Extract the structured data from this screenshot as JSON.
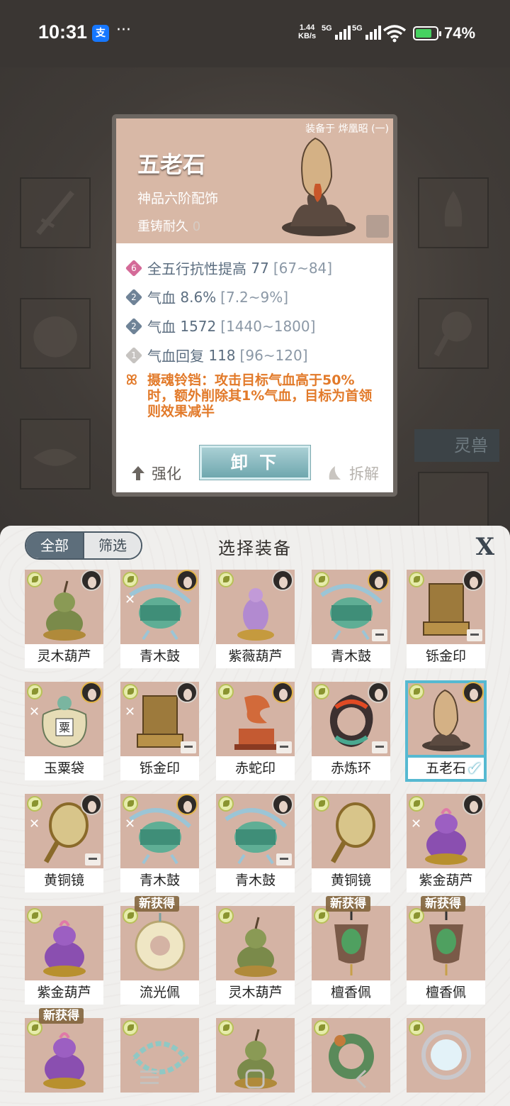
{
  "status_bar": {
    "time": "10:31",
    "alipay": "支",
    "more": "···",
    "net_speed_top": "1.44",
    "net_speed_unit": "KB/s",
    "sig1": "5G",
    "sig2": "5G",
    "battery": "74%"
  },
  "background": {
    "spirit_beast_label": "灵兽"
  },
  "detail": {
    "equipped_on": "装备于 烨凰昭 (一)",
    "name": "五老石",
    "grade": "神品六阶配饰",
    "durability_label": "重铸耐久",
    "durability_value": "0",
    "stats": [
      {
        "level": "6",
        "name": "全五行抗性提高",
        "value": "77",
        "range": "[67~84]"
      },
      {
        "level": "2",
        "name": "气血",
        "value": "8.6%",
        "range": "[7.2~9%]"
      },
      {
        "level": "2",
        "name": "气血",
        "value": "1572",
        "range": "[1440~1800]"
      },
      {
        "level": "1",
        "name": "气血回复",
        "value": "118",
        "range": "[96~120]"
      }
    ],
    "special_icon": "ꕤ",
    "special": "摄魂铃铛：攻击目标气血高于50%时，额外削除其1%气血，目标为首领则效果减半",
    "strengthen_label": "强化",
    "unequip_label": "卸 下",
    "salvage_label": "拆解"
  },
  "panel": {
    "tab_all": "全部",
    "tab_filter": "筛选",
    "title": "选择装备",
    "close": "X",
    "new_tag": "新获得",
    "items": [
      {
        "label": "灵木葫芦",
        "avatar": true,
        "mark": false,
        "lock": false,
        "new": false,
        "selected": false,
        "art": "gourd-green"
      },
      {
        "label": "青木鼓",
        "avatar": true,
        "mark": true,
        "lock": false,
        "new": false,
        "selected": false,
        "art": "drum"
      },
      {
        "label": "紫薇葫芦",
        "avatar": true,
        "mark": false,
        "lock": false,
        "new": false,
        "selected": false,
        "art": "gourd-purple-slim"
      },
      {
        "label": "青木鼓",
        "avatar": true,
        "mark": false,
        "lock": true,
        "new": false,
        "selected": false,
        "art": "drum"
      },
      {
        "label": "铄金印",
        "avatar": true,
        "mark": false,
        "lock": true,
        "new": false,
        "selected": false,
        "art": "seal-gold"
      },
      {
        "label": "玉粟袋",
        "avatar": true,
        "mark": true,
        "lock": false,
        "new": false,
        "selected": false,
        "art": "bag"
      },
      {
        "label": "铄金印",
        "avatar": true,
        "mark": true,
        "lock": true,
        "new": false,
        "selected": false,
        "art": "seal-gold"
      },
      {
        "label": "赤蛇印",
        "avatar": true,
        "mark": false,
        "lock": true,
        "new": false,
        "selected": false,
        "art": "seal-snake"
      },
      {
        "label": "赤炼环",
        "avatar": true,
        "mark": false,
        "lock": true,
        "new": false,
        "selected": false,
        "art": "ring-red"
      },
      {
        "label": "五老石",
        "avatar": true,
        "mark": false,
        "lock": false,
        "new": false,
        "selected": true,
        "art": "stone"
      },
      {
        "label": "黄铜镜",
        "avatar": true,
        "mark": true,
        "lock": true,
        "new": false,
        "selected": false,
        "art": "mirror"
      },
      {
        "label": "青木鼓",
        "avatar": true,
        "mark": true,
        "lock": false,
        "new": false,
        "selected": false,
        "art": "drum"
      },
      {
        "label": "青木鼓",
        "avatar": true,
        "mark": false,
        "lock": true,
        "new": false,
        "selected": false,
        "art": "drum"
      },
      {
        "label": "黄铜镜",
        "avatar": false,
        "mark": false,
        "lock": false,
        "new": false,
        "selected": false,
        "art": "mirror"
      },
      {
        "label": "紫金葫芦",
        "avatar": true,
        "mark": true,
        "lock": false,
        "new": false,
        "selected": false,
        "art": "gourd-purple"
      },
      {
        "label": "紫金葫芦",
        "avatar": false,
        "mark": false,
        "lock": false,
        "new": false,
        "selected": false,
        "art": "gourd-purple"
      },
      {
        "label": "流光佩",
        "avatar": false,
        "mark": false,
        "lock": false,
        "new": true,
        "selected": false,
        "art": "jade-disc"
      },
      {
        "label": "灵木葫芦",
        "avatar": false,
        "mark": false,
        "lock": false,
        "new": false,
        "selected": false,
        "art": "gourd-green"
      },
      {
        "label": "檀香佩",
        "avatar": false,
        "mark": false,
        "lock": false,
        "new": true,
        "selected": false,
        "art": "pendant"
      },
      {
        "label": "檀香佩",
        "avatar": false,
        "mark": false,
        "lock": false,
        "new": true,
        "selected": false,
        "art": "pendant"
      },
      {
        "label": "",
        "avatar": false,
        "mark": false,
        "lock": false,
        "new": true,
        "selected": false,
        "art": "gourd-purple"
      },
      {
        "label": "",
        "avatar": false,
        "mark": false,
        "lock": false,
        "new": false,
        "selected": false,
        "art": "chain"
      },
      {
        "label": "",
        "avatar": false,
        "mark": false,
        "lock": false,
        "new": false,
        "selected": false,
        "art": "gourd-green"
      },
      {
        "label": "",
        "avatar": false,
        "mark": false,
        "lock": false,
        "new": false,
        "selected": false,
        "art": "ring-green"
      },
      {
        "label": "",
        "avatar": false,
        "mark": false,
        "lock": false,
        "new": false,
        "selected": false,
        "art": "mirror-round"
      }
    ]
  },
  "colors": {
    "accent": "#56b9d1",
    "special_text": "#e27a2a",
    "item_bg": "#d4b3a4"
  },
  "icons": {
    "nav": [
      "menu-icon",
      "home-icon",
      "back-icon"
    ]
  }
}
